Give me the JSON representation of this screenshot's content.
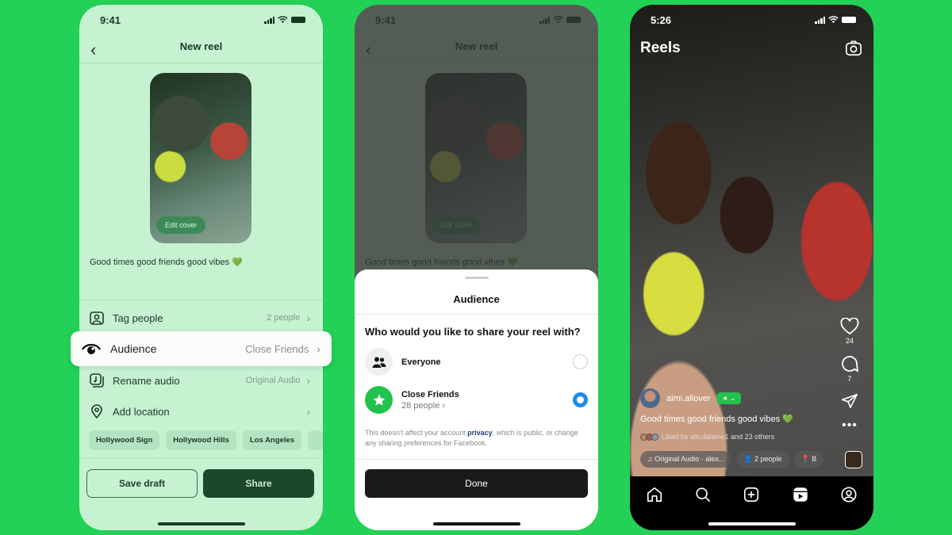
{
  "colors": {
    "background": "#22d155",
    "editor_bg": "#c6f2d2",
    "share_button": "#1c4729",
    "radio_selected": "#1d8ded",
    "close_friends_green": "#22c24d"
  },
  "screen1": {
    "status_time": "9:41",
    "title": "New reel",
    "back_icon": "chevron-left",
    "edit_cover_label": "Edit cover",
    "caption": "Good times good friends good vibes 💚",
    "rows": [
      {
        "icon": "tag-person-icon",
        "label": "Tag people",
        "value": "2 people"
      },
      {
        "icon": "audience-eye-icon",
        "label": "Audience",
        "value": "Close Friends"
      },
      {
        "icon": "audio-icon",
        "label": "Rename audio",
        "value": "Original Audio"
      },
      {
        "icon": "location-pin-icon",
        "label": "Add location",
        "value": ""
      }
    ],
    "location_chips": [
      "Hollywood Sign",
      "Hollywood Hills",
      "Los Angeles"
    ],
    "save_draft_label": "Save draft",
    "share_label": "Share"
  },
  "screen2": {
    "status_time": "9:41",
    "title": "New reel",
    "edit_cover_label": "Edit cover",
    "caption": "Good times good friends good vibes 💚",
    "sheet": {
      "title": "Audience",
      "question": "Who would you like to share your reel with?",
      "options": [
        {
          "label": "Everyone",
          "sub": "",
          "icon": "people-icon",
          "selected": false
        },
        {
          "label": "Close Friends",
          "sub": "28 people ›",
          "icon": "star-icon",
          "selected": true
        }
      ],
      "note_before": "This doesn't affect your account ",
      "note_link": "privacy",
      "note_after": ", which is public, or change any sharing preferences for Facebook.",
      "done_label": "Done"
    }
  },
  "screen3": {
    "status_time": "5:26",
    "title": "Reels",
    "likes": "24",
    "comments": "7",
    "username": "aimi.allover",
    "badge": "★ ⌄",
    "caption": "Good times good friends good vibes 💚",
    "liked_by": "Liked by alo.dalaine1 and 23 others",
    "pills": [
      "♫ Original Audio · alex...",
      "👤 2 people",
      "📍 B"
    ],
    "tabs": [
      "home-icon",
      "search-icon",
      "create-icon",
      "reels-icon",
      "profile-icon"
    ]
  }
}
